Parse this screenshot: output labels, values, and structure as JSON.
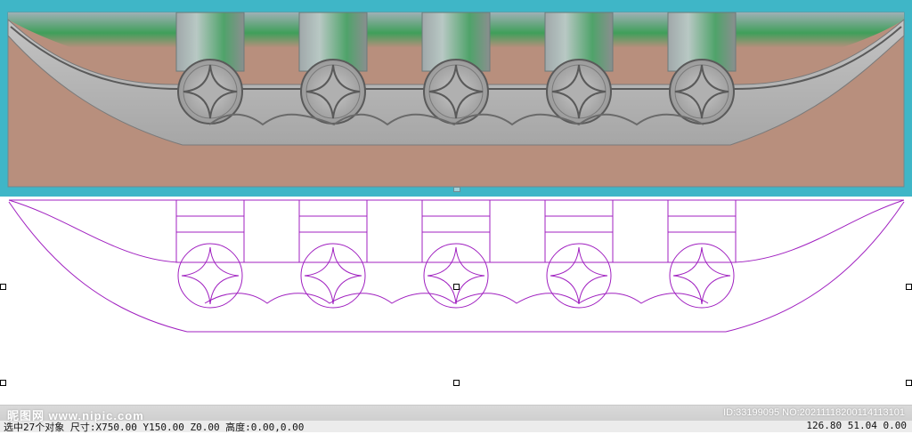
{
  "views": {
    "render_view": "3d-relief-preview",
    "wireframe_view": "2d-vector-outline"
  },
  "colors": {
    "background_3d": "#3fb6c7",
    "relief_gray": "#b4b4b4",
    "relief_tan": "#b88f7d",
    "relief_green": "#3f9f5a",
    "vector_lines": "#a020c0",
    "selection_handle": "#000000"
  },
  "status": {
    "selection_text": "选中27个对象 尺寸:X750.00 Y150.00 Z0.00 高度:0.00,0.00",
    "coords_text": "126.80 51.04 0.00"
  },
  "watermark": {
    "site_text": "昵图网 www.nipic.com",
    "id_text": "ID:33199095 NO:20211118200114113101"
  }
}
